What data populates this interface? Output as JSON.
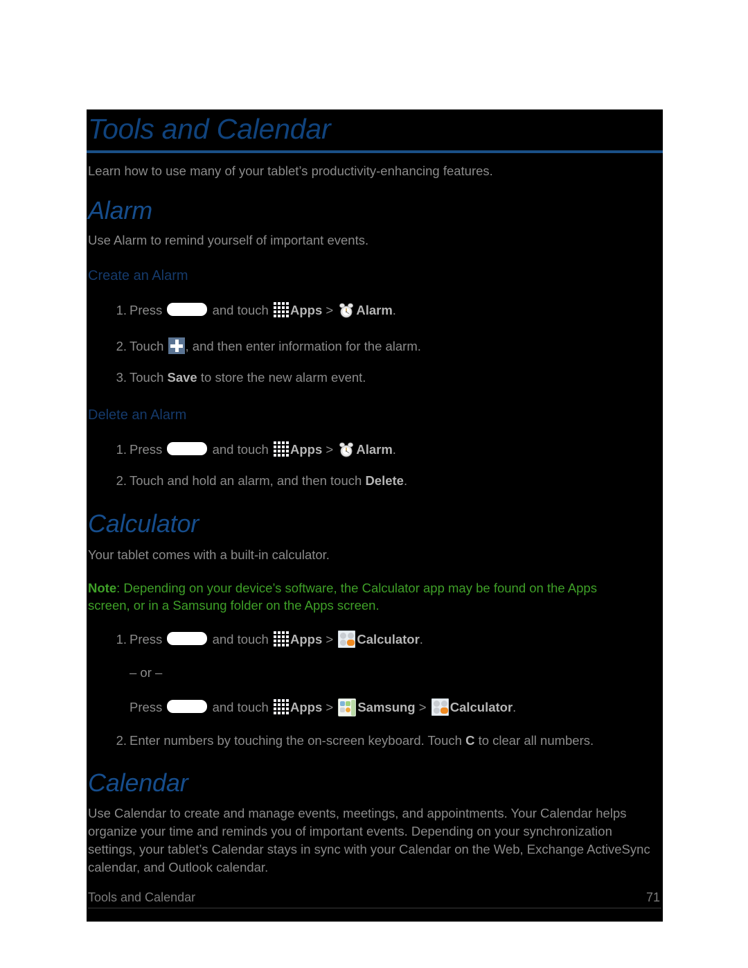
{
  "document": {
    "chapter_title": "Tools and Calendar",
    "intro": "Learn how to use many of your tablet’s productivity-enhancing features."
  },
  "colors": {
    "page_background": "#ffffff",
    "content_background": "#000000",
    "heading_blue": "#164d8c",
    "subheading_blue": "#153a6b",
    "title_rule": "#1a4f86",
    "body_gray": "#8b8b8b",
    "note_green": "#3fa028",
    "calc_accent_orange": "#ef8a22",
    "plus_tile_blue": "#5b7493"
  },
  "sections": [
    {
      "id": "alarm",
      "heading": "Alarm",
      "intro": "Use Alarm to remind yourself of important events.",
      "subsections": [
        {
          "id": "create-an-alarm",
          "heading": "Create an Alarm",
          "steps": [
            {
              "number": "1.",
              "parts": [
                {
                  "type": "text",
                  "value": "Press "
                },
                {
                  "type": "icon",
                  "name": "home-key-icon"
                },
                {
                  "type": "text",
                  "value": " and touch "
                },
                {
                  "type": "icon",
                  "name": "apps-grid-icon"
                },
                {
                  "type": "bold",
                  "value": "Apps"
                },
                {
                  "type": "text",
                  "value": " > "
                },
                {
                  "type": "icon",
                  "name": "alarm-clock-icon"
                },
                {
                  "type": "bold",
                  "value": "Alarm"
                },
                {
                  "type": "text",
                  "value": "."
                }
              ]
            },
            {
              "number": "2.",
              "parts": [
                {
                  "type": "text",
                  "value": "Touch "
                },
                {
                  "type": "icon",
                  "name": "plus-tile-icon"
                },
                {
                  "type": "text",
                  "value": ", and then enter information for the alarm."
                }
              ]
            },
            {
              "number": "3.",
              "parts": [
                {
                  "type": "text",
                  "value": "Touch "
                },
                {
                  "type": "bold",
                  "value": "Save"
                },
                {
                  "type": "text",
                  "value": " to store the new alarm event."
                }
              ]
            }
          ]
        },
        {
          "id": "delete-an-alarm",
          "heading": "Delete an Alarm",
          "steps": [
            {
              "number": "1.",
              "parts": [
                {
                  "type": "text",
                  "value": "Press "
                },
                {
                  "type": "icon",
                  "name": "home-key-icon"
                },
                {
                  "type": "text",
                  "value": " and touch "
                },
                {
                  "type": "icon",
                  "name": "apps-grid-icon"
                },
                {
                  "type": "bold",
                  "value": "Apps"
                },
                {
                  "type": "text",
                  "value": " > "
                },
                {
                  "type": "icon",
                  "name": "alarm-clock-icon"
                },
                {
                  "type": "bold",
                  "value": "Alarm"
                },
                {
                  "type": "text",
                  "value": "."
                }
              ]
            },
            {
              "number": "2.",
              "parts": [
                {
                  "type": "text",
                  "value": "Touch and hold an alarm, and then touch "
                },
                {
                  "type": "bold",
                  "value": "Delete"
                },
                {
                  "type": "text",
                  "value": "."
                }
              ]
            }
          ]
        }
      ]
    },
    {
      "id": "calculator",
      "heading": "Calculator",
      "intro": "Your tablet comes with a built-in calculator.",
      "note": {
        "label": "Note",
        "text": ": Depending on your device’s software, the Calculator app may be found on the Apps screen, or in a Samsung folder on the Apps screen."
      },
      "or_separator": "– or –",
      "steps": [
        {
          "number": "1.",
          "parts": [
            {
              "type": "text",
              "value": "Press "
            },
            {
              "type": "icon",
              "name": "home-key-icon"
            },
            {
              "type": "text",
              "value": " and touch "
            },
            {
              "type": "icon",
              "name": "apps-grid-icon"
            },
            {
              "type": "bold",
              "value": "Apps"
            },
            {
              "type": "text",
              "value": " > "
            },
            {
              "type": "icon",
              "name": "calculator-icon"
            },
            {
              "type": "bold",
              "value": "Calculator"
            },
            {
              "type": "text",
              "value": "."
            }
          ]
        },
        {
          "number": "2.",
          "parts": [
            {
              "type": "text",
              "value": "Enter numbers by touching the on-screen keyboard. Touch "
            },
            {
              "type": "bold",
              "value": "C"
            },
            {
              "type": "text",
              "value": " to clear all numbers."
            }
          ]
        }
      ],
      "alt_step_parts": [
        {
          "type": "text",
          "value": "Press "
        },
        {
          "type": "icon",
          "name": "home-key-icon"
        },
        {
          "type": "text",
          "value": " and touch "
        },
        {
          "type": "icon",
          "name": "apps-grid-icon"
        },
        {
          "type": "bold",
          "value": "Apps"
        },
        {
          "type": "text",
          "value": " > "
        },
        {
          "type": "icon",
          "name": "samsung-folder-icon"
        },
        {
          "type": "bold",
          "value": "Samsung"
        },
        {
          "type": "text",
          "value": " > "
        },
        {
          "type": "icon",
          "name": "calculator-icon"
        },
        {
          "type": "bold",
          "value": "Calculator"
        },
        {
          "type": "text",
          "value": "."
        }
      ]
    },
    {
      "id": "calendar",
      "heading": "Calendar",
      "intro": "Use Calendar to create and manage events, meetings, and appointments. Your Calendar helps organize your time and reminds you of important events. Depending on your synchronization settings, your tablet’s Calendar stays in sync with your Calendar on the Web, Exchange ActiveSync calendar, and Outlook calendar."
    }
  ],
  "footer": {
    "title": "Tools and Calendar",
    "page_number": "71"
  }
}
